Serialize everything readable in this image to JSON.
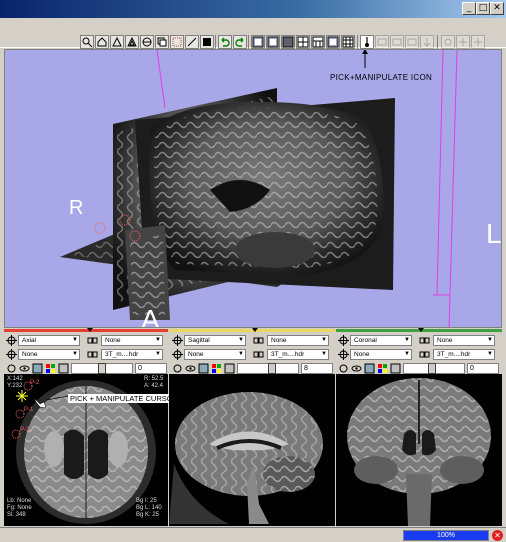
{
  "window": {
    "minimize_glyph": "_",
    "maximize_glyph": "□",
    "close_glyph": "✕"
  },
  "toolbar": {
    "icons": [
      "zoom-icon",
      "home-icon",
      "tri-icon",
      "tri2-icon",
      "globe-icon",
      "copy-icon",
      "select-icon",
      "line-icon",
      "square-icon",
      "undo-icon",
      "redo-icon",
      "layout-1",
      "layout-2",
      "layout-3",
      "layout-4",
      "layout-5",
      "layout-6",
      "layout-7",
      "grid-icon",
      "pick-manipulate-icon",
      "icon-a",
      "icon-b",
      "icon-c",
      "icon-d",
      "icon-e",
      "icon-f",
      "icon-g"
    ]
  },
  "view3d": {
    "annotation": "PICK+MANIPULATE ICON",
    "orient_right": "R",
    "orient_left": "L",
    "orient_anterior": "A"
  },
  "panels": [
    {
      "accent": "#e84030",
      "orientation": "Axial",
      "overlay1": "None",
      "overlay2": "None",
      "file": "3T_m....hdr",
      "slice_value": "0"
    },
    {
      "accent": "#e8d860",
      "orientation": "Sagittal",
      "overlay1": "None",
      "overlay2": "None",
      "file": "3T_m....hdr",
      "slice_value": "8"
    },
    {
      "accent": "#40a040",
      "orientation": "Coronal",
      "overlay1": "None",
      "overlay2": "None",
      "file": "3T_m....hdr",
      "slice_value": "0"
    }
  ],
  "axial_overlay": {
    "top_left_1": "X:142",
    "top_left_2": "Y:232",
    "top_right_1": "R: 52.5",
    "top_right_2": "A: 42.4",
    "pick_label_1": "P-2",
    "pick_label_2": "P-1",
    "pick_label_3": "P-3",
    "cursor_annotation": "PICK + MANIPULATE CURSOR",
    "bottom_left_1": "Lb: None",
    "bottom_left_2": "Fg: None",
    "bottom_left_3": "Sl: 348",
    "bottom_right_1": "Bg I: 25",
    "bottom_right_2": "Bg L: 140",
    "bottom_right_3": "Bg K: 25"
  },
  "status": {
    "progress_text": "100%",
    "progress_fraction": 1.0,
    "stop_glyph": "✕"
  }
}
